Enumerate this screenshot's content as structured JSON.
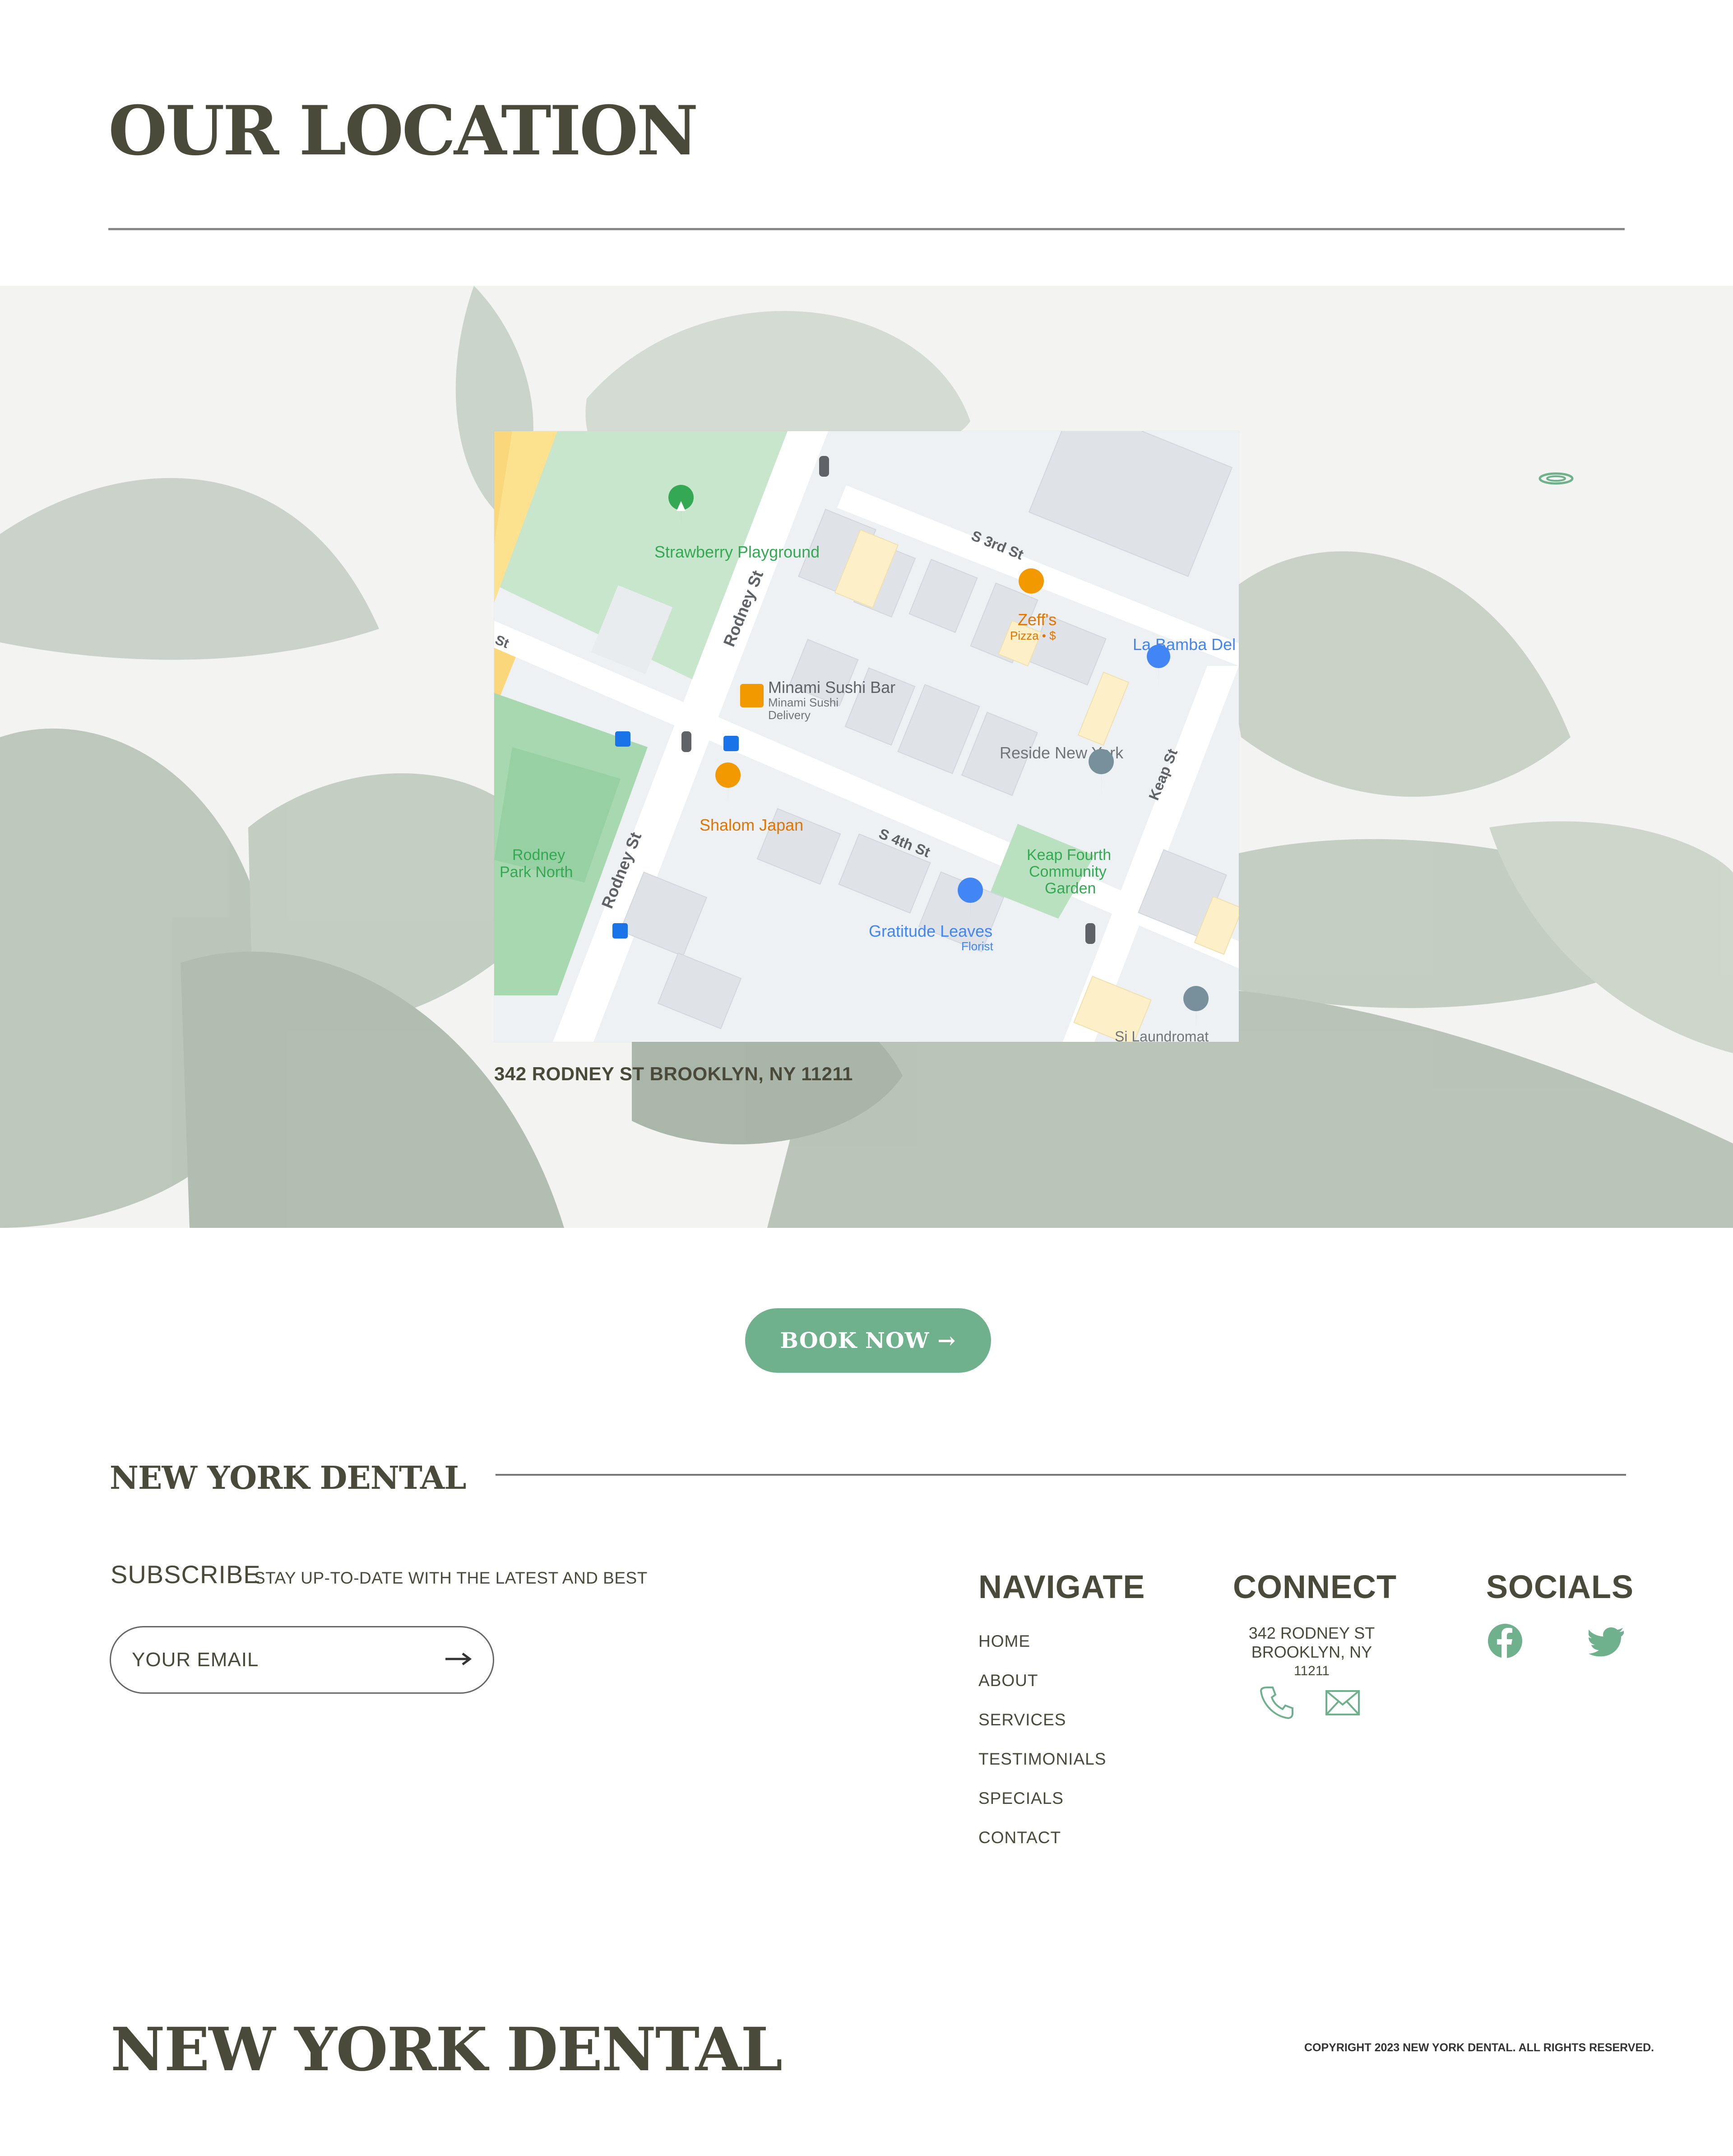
{
  "location": {
    "title": "OUR LOCATION",
    "address": "342 RODNEY ST BROOKLYN, NY 11211"
  },
  "map": {
    "labels": {
      "strawberry": "Strawberry Playground",
      "rodney_st_1": "Rodney St",
      "rodney_st_2": "Rodney St",
      "s3rd": "S 3rd St",
      "s4th": "S 4th St",
      "keap": "Keap St",
      "zeffs": "Zeff's",
      "zeffs_sub": "Pizza • $",
      "labamba": "La Bamba Del",
      "minami": "Minami Sushi Bar",
      "minami_sub1": "Minami Sushi",
      "minami_sub2": "Delivery",
      "reside": "Reside New York",
      "shalom": "Shalom Japan",
      "rodney_park_1": "Rodney",
      "rodney_park_2": "Park North",
      "keap_garden_1": "Keap Fourth",
      "keap_garden_2": "Community",
      "keap_garden_3": "Garden",
      "gratitude": "Gratitude Leaves",
      "gratitude_sub": "Florist",
      "st_left": "St",
      "laundromat": "Si Laundromat"
    }
  },
  "cta": {
    "book_label": "BOOK NOW →"
  },
  "footer": {
    "brand": "NEW YORK DENTAL",
    "subscribe_title": "SUBSCRIBE",
    "subscribe_sub": "STAY UP-TO-DATE WITH THE LATEST AND BEST",
    "email_placeholder": "YOUR EMAIL",
    "navigate_title": "NAVIGATE",
    "nav": [
      "HOME",
      "ABOUT",
      "SERVICES",
      "TESTIMONIALS",
      "SPECIALS",
      "CONTACT"
    ],
    "connect_title": "CONNECT",
    "connect_address_1": "342 RODNEY ST",
    "connect_address_2": "BROOKLYN, NY",
    "connect_address_3": "11211",
    "socials_title": "SOCIALS",
    "brand_big": "NEW YORK DENTAL",
    "copyright": "COPYRIGHT 2023 NEW YORK DENTAL. ALL RIGHTS RESERVED."
  },
  "colors": {
    "accent": "#6fb08d",
    "text": "#4a4a3a"
  },
  "icons": [
    "ring-icon",
    "arrow-right-icon",
    "phone-icon",
    "mail-icon",
    "facebook-icon",
    "twitter-icon"
  ]
}
